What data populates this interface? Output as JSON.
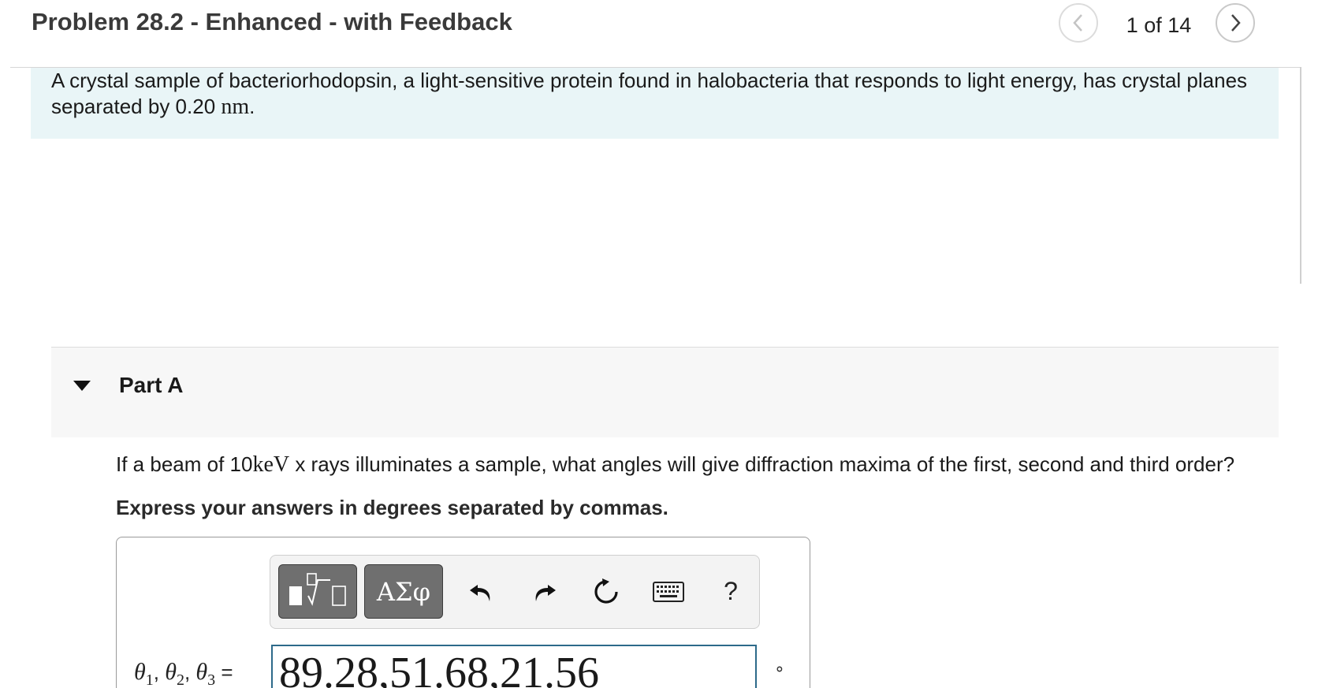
{
  "header": {
    "title": "Problem 28.2 - Enhanced - with Feedback",
    "counter": "1 of 14",
    "prev_icon": "chevron-left-icon",
    "next_icon": "chevron-right-icon"
  },
  "intro": {
    "text_before": "A crystal sample of bacteriorhodopsin, a light-sensitive protein found in halobacteria that responds to light energy, has crystal planes separated by 0.20 ",
    "unit": "nm",
    "text_after": "."
  },
  "part_a": {
    "title": "Part A",
    "question_before": "If a beam of 10",
    "question_unit": "keV",
    "question_after": " x rays illuminates a sample, what angles will give diffraction maxima of the first, second and third order?",
    "instruction": "Express your answers in degrees separated by commas."
  },
  "toolbar": {
    "template_icon": "template-sqrt-icon",
    "greek_label": "ΑΣφ",
    "undo_icon": "undo-icon",
    "redo_icon": "redo-icon",
    "reset_icon": "reset-icon",
    "keyboard_icon": "keyboard-icon",
    "help_label": "?"
  },
  "answer": {
    "label_theta": "θ",
    "sub1": "1",
    "sub2": "2",
    "sub3": "3",
    "sep": ", ",
    "equals": " =",
    "value": "89.28,51.68,21.56",
    "unit": "∘"
  },
  "colors": {
    "intro_bg": "#e9f5f7",
    "part_header_bg": "#f7f7f7",
    "input_border": "#2d6a8a",
    "toolbar_button": "#6f6f6f"
  }
}
